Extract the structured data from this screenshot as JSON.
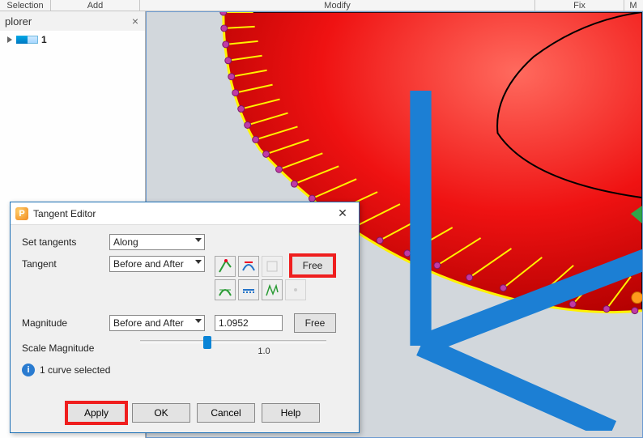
{
  "toolbar": {
    "sections": [
      "Selection",
      "Add",
      "Modify",
      "Fix",
      "M"
    ]
  },
  "explorer": {
    "title": "plorer",
    "root_label": "1"
  },
  "dialog": {
    "title": "Tangent Editor",
    "labels": {
      "set_tangents": "Set tangents",
      "tangent": "Tangent",
      "magnitude": "Magnitude",
      "scale_magnitude": "Scale Magnitude"
    },
    "values": {
      "set_tangents": "Along",
      "tangent_mode": "Before and After",
      "magnitude_mode": "Before and After",
      "magnitude_value": "1.0952",
      "free": "Free",
      "slider_label": "1.0"
    },
    "status": "1 curve selected",
    "buttons": {
      "apply": "Apply",
      "ok": "OK",
      "cancel": "Cancel",
      "help": "Help"
    }
  }
}
